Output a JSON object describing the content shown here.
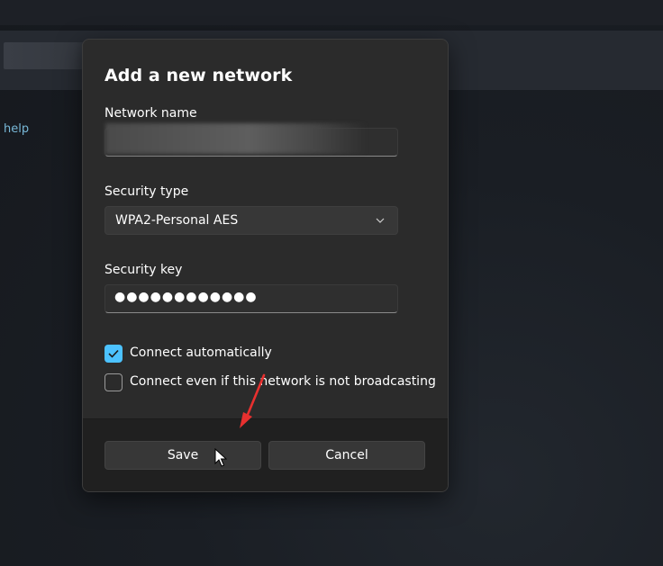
{
  "background": {
    "help_link": "help"
  },
  "dialog": {
    "title": "Add a new network",
    "network_name": {
      "label": "Network name",
      "value": ""
    },
    "security_type": {
      "label": "Security type",
      "selected": "WPA2-Personal AES"
    },
    "security_key": {
      "label": "Security key",
      "masked_value": "●●●●●●●●●●●●"
    },
    "checkboxes": [
      {
        "label": "Connect automatically",
        "checked": true
      },
      {
        "label": "Connect even if this network is not broadcasting",
        "checked": false
      }
    ],
    "buttons": {
      "save": "Save",
      "cancel": "Cancel"
    }
  },
  "colors": {
    "accent": "#4cc2ff",
    "dialog_bg": "#2b2b2b",
    "footer_bg": "#202020",
    "annotation_arrow": "#e8302f"
  }
}
